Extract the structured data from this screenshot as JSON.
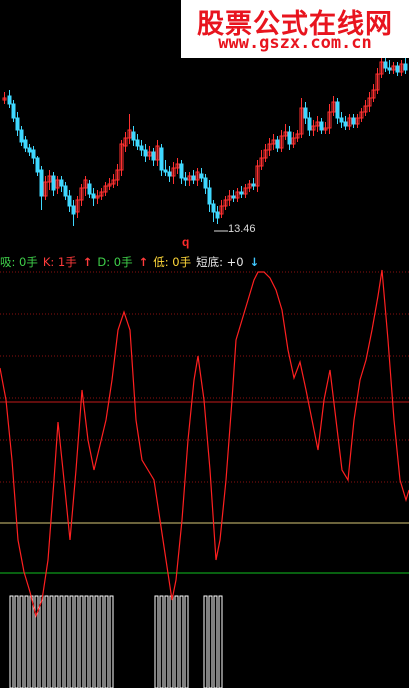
{
  "watermark": {
    "title": "股票公式在线网",
    "url": "www.gszx.com.cn"
  },
  "main_chart": {
    "low_price_label": "13.46",
    "marker": "q"
  },
  "indicator": {
    "legend": [
      {
        "label": "吸: 0手",
        "color": "#3fd04a"
      },
      {
        "label": "K: 1手",
        "color": "#ff3b3b",
        "arrow": "↑",
        "arrow_color": "#ff3b3b"
      },
      {
        "label": "D: 0手",
        "color": "#3fd04a",
        "arrow": "↑",
        "arrow_color": "#ff3b3b"
      },
      {
        "label": "低: 0手",
        "color": "#ffd83a"
      },
      {
        "label": "短底: +0",
        "color": "#e8e8e8",
        "arrow": "↓",
        "arrow_color": "#40c8ff"
      }
    ],
    "colors": {
      "line": "#ff2020",
      "grid": "#8a1010",
      "yellow_level": "#d8c878",
      "green_level": "#10c020",
      "bars": "#ffffff"
    }
  },
  "colors": {
    "up": "#ff3030",
    "down": "#3fd8ff",
    "background": "#000000"
  }
}
